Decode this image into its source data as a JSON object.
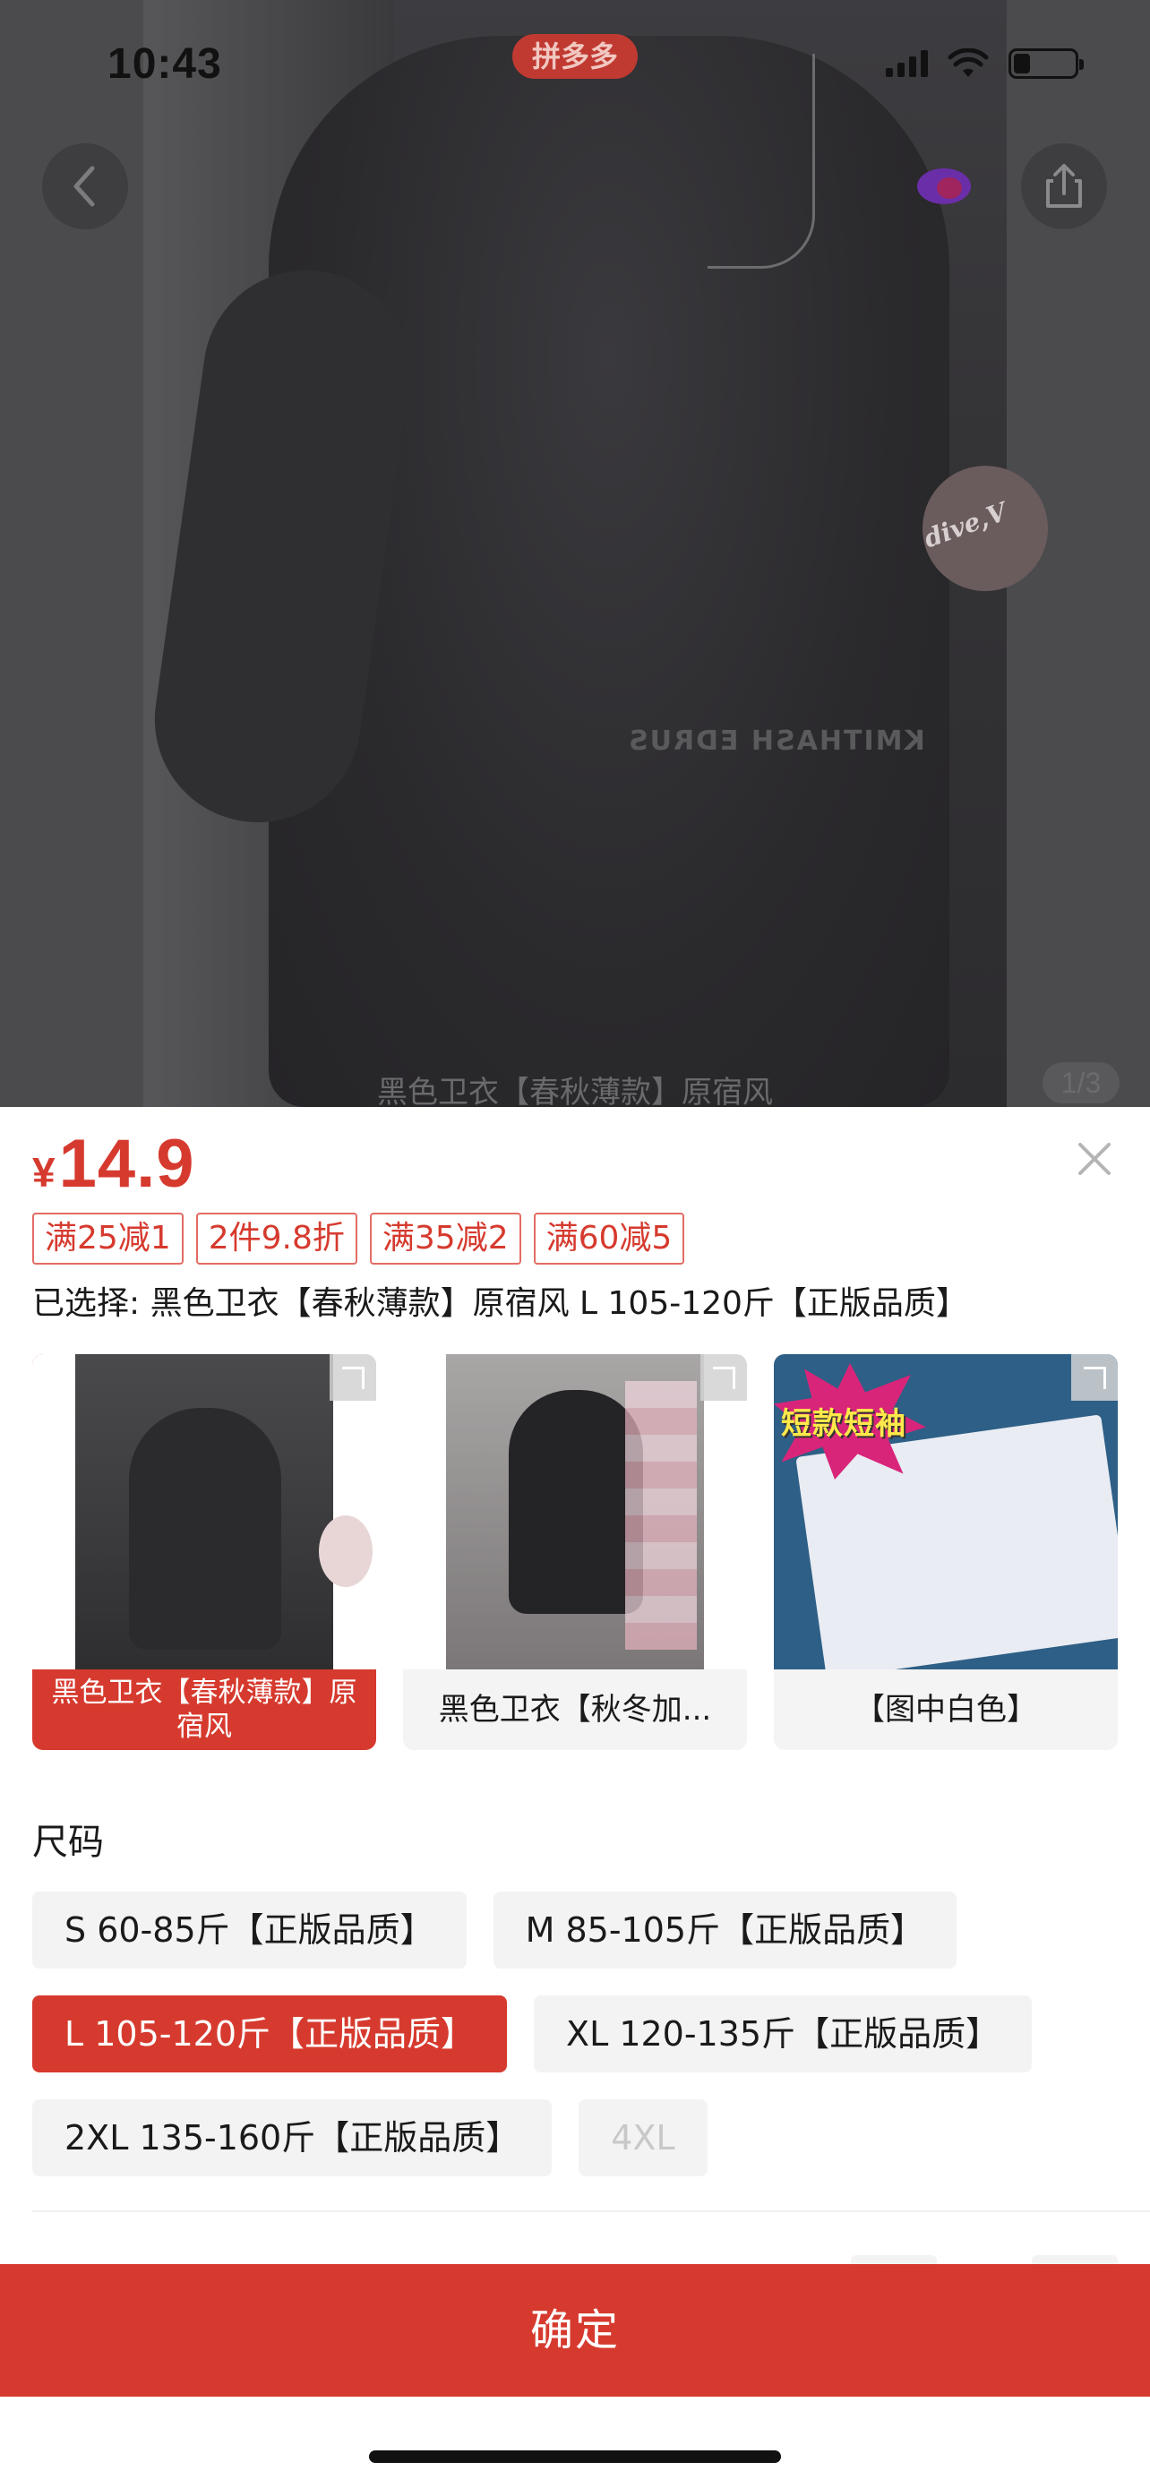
{
  "status_bar": {
    "time": "10:43",
    "brand": "拼多多"
  },
  "hero": {
    "caption": "黑色卫衣【春秋薄款】原宿风",
    "counter": "1/3",
    "print_text": "KMITHASH EDRUS",
    "sticker_text": "dive,V"
  },
  "sheet": {
    "price_symbol": "¥",
    "price": "14.9",
    "coupons": [
      "满25减1",
      "2件9.8折",
      "满35减2",
      "满60减5"
    ],
    "selected_text": "已选择: 黑色卫衣【春秋薄款】原宿风 L 105-120斤【正版品质】",
    "variants": [
      {
        "label": "黑色卫衣【春秋薄款】原宿风",
        "selected": true
      },
      {
        "label": "黑色卫衣【秋冬加...",
        "selected": false
      },
      {
        "label": "【图中白色】",
        "selected": false,
        "badge": "短款短袖"
      }
    ],
    "size_title": "尺码",
    "sizes": [
      {
        "label": "S 60-85斤【正版品质】",
        "state": "normal"
      },
      {
        "label": "M 85-105斤【正版品质】",
        "state": "normal"
      },
      {
        "label": "L 105-120斤【正版品质】",
        "state": "selected"
      },
      {
        "label": "XL 120-135斤【正版品质】",
        "state": "normal"
      },
      {
        "label": "2XL 135-160斤【正版品质】",
        "state": "normal"
      },
      {
        "label": "4XL",
        "state": "disabled"
      }
    ],
    "confirm_label": "确定"
  },
  "colors": {
    "accent": "#d63a2e",
    "chip_bg": "#f3f3f3",
    "disabled_text": "#c8c8c8"
  },
  "icons": {
    "back": "chevron-left-icon",
    "share": "share-icon",
    "close": "close-icon",
    "expand": "expand-icon"
  }
}
